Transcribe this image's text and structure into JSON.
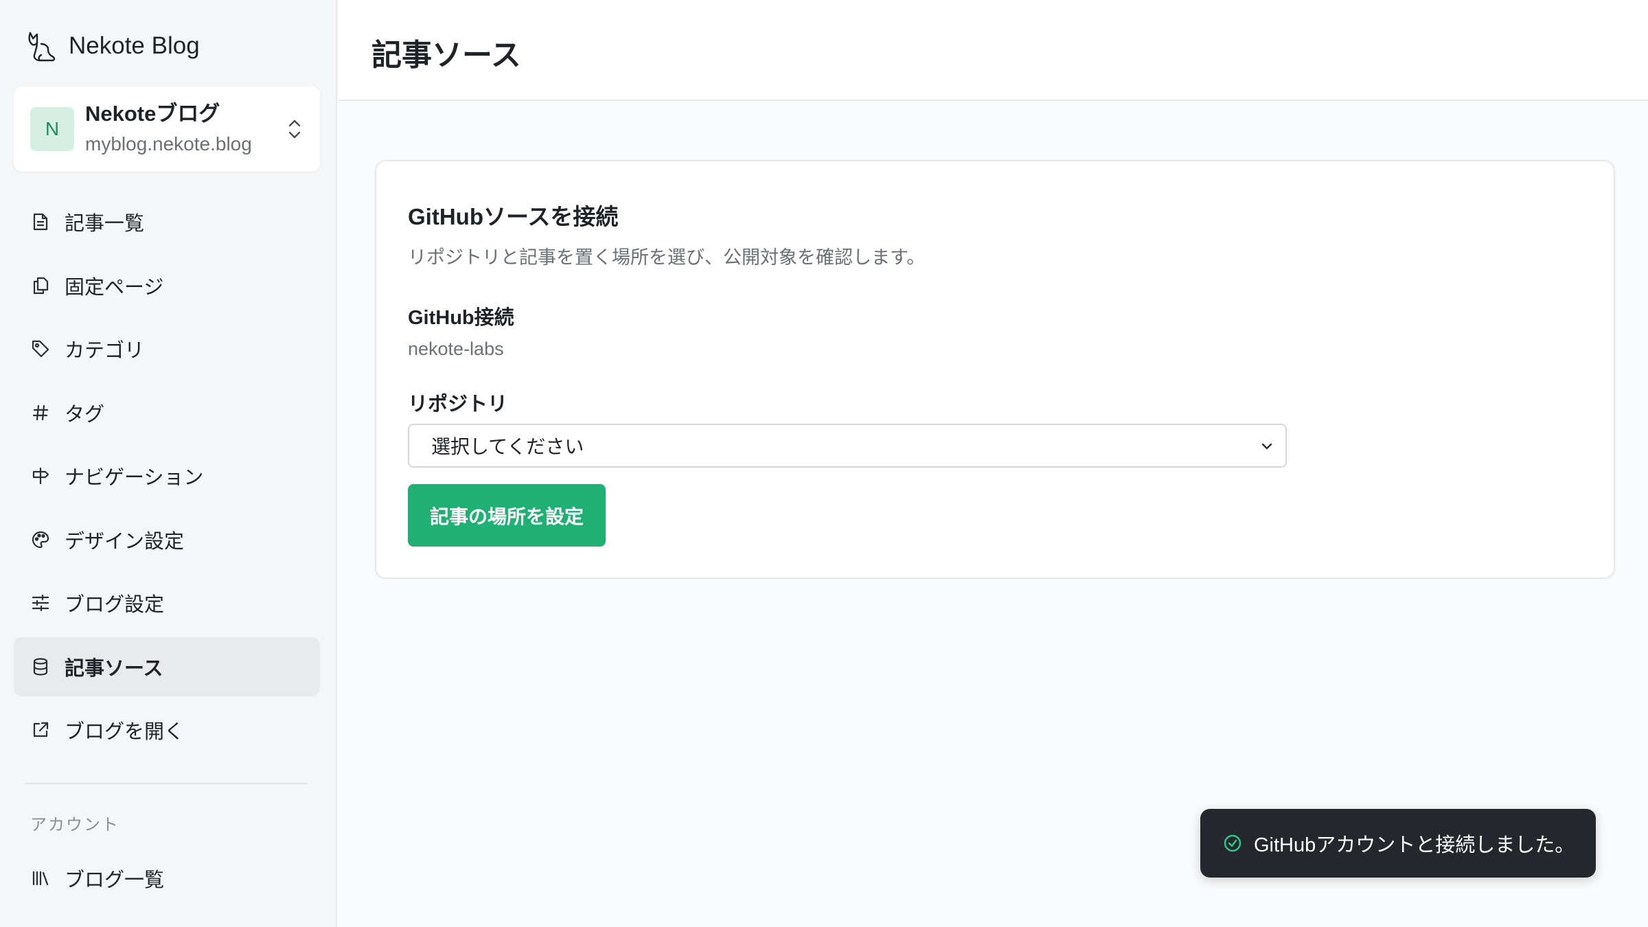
{
  "app": {
    "brand": "Nekote Blog",
    "logo_icon": "cat-logo-icon"
  },
  "blog_switcher": {
    "avatar_letter": "N",
    "title": "Nekoteブログ",
    "domain": "myblog.nekote.blog",
    "icon": "chevron-up-down-icon"
  },
  "sidebar": {
    "items": [
      {
        "label": "記事一覧",
        "icon": "document-icon",
        "active": false
      },
      {
        "label": "固定ページ",
        "icon": "pages-icon",
        "active": false
      },
      {
        "label": "カテゴリ",
        "icon": "tag-icon",
        "active": false
      },
      {
        "label": "タグ",
        "icon": "hash-icon",
        "active": false
      },
      {
        "label": "ナビゲーション",
        "icon": "signpost-icon",
        "active": false
      },
      {
        "label": "デザイン設定",
        "icon": "palette-icon",
        "active": false
      },
      {
        "label": "ブログ設定",
        "icon": "sliders-icon",
        "active": false
      },
      {
        "label": "記事ソース",
        "icon": "database-icon",
        "active": true
      },
      {
        "label": "ブログを開く",
        "icon": "external-link-icon",
        "active": false
      }
    ],
    "account_section": "アカウント",
    "account_items": [
      {
        "label": "ブログ一覧",
        "icon": "library-icon"
      }
    ]
  },
  "header": {
    "title": "記事ソース"
  },
  "card": {
    "title": "GitHubソースを接続",
    "description": "リポジトリと記事を置く場所を選び、公開対象を確認します。",
    "github_label": "GitHub接続",
    "github_value": "nekote-labs",
    "repo_label": "リポジトリ",
    "repo_select_value": "選択してください",
    "submit_label": "記事の場所を設定"
  },
  "toast": {
    "message": "GitHubアカウントと接続しました。",
    "icon": "check-circle-icon"
  },
  "colors": {
    "accent": "#1fb173",
    "avatar_bg": "#d5efe2",
    "toast_bg": "#24272b"
  }
}
